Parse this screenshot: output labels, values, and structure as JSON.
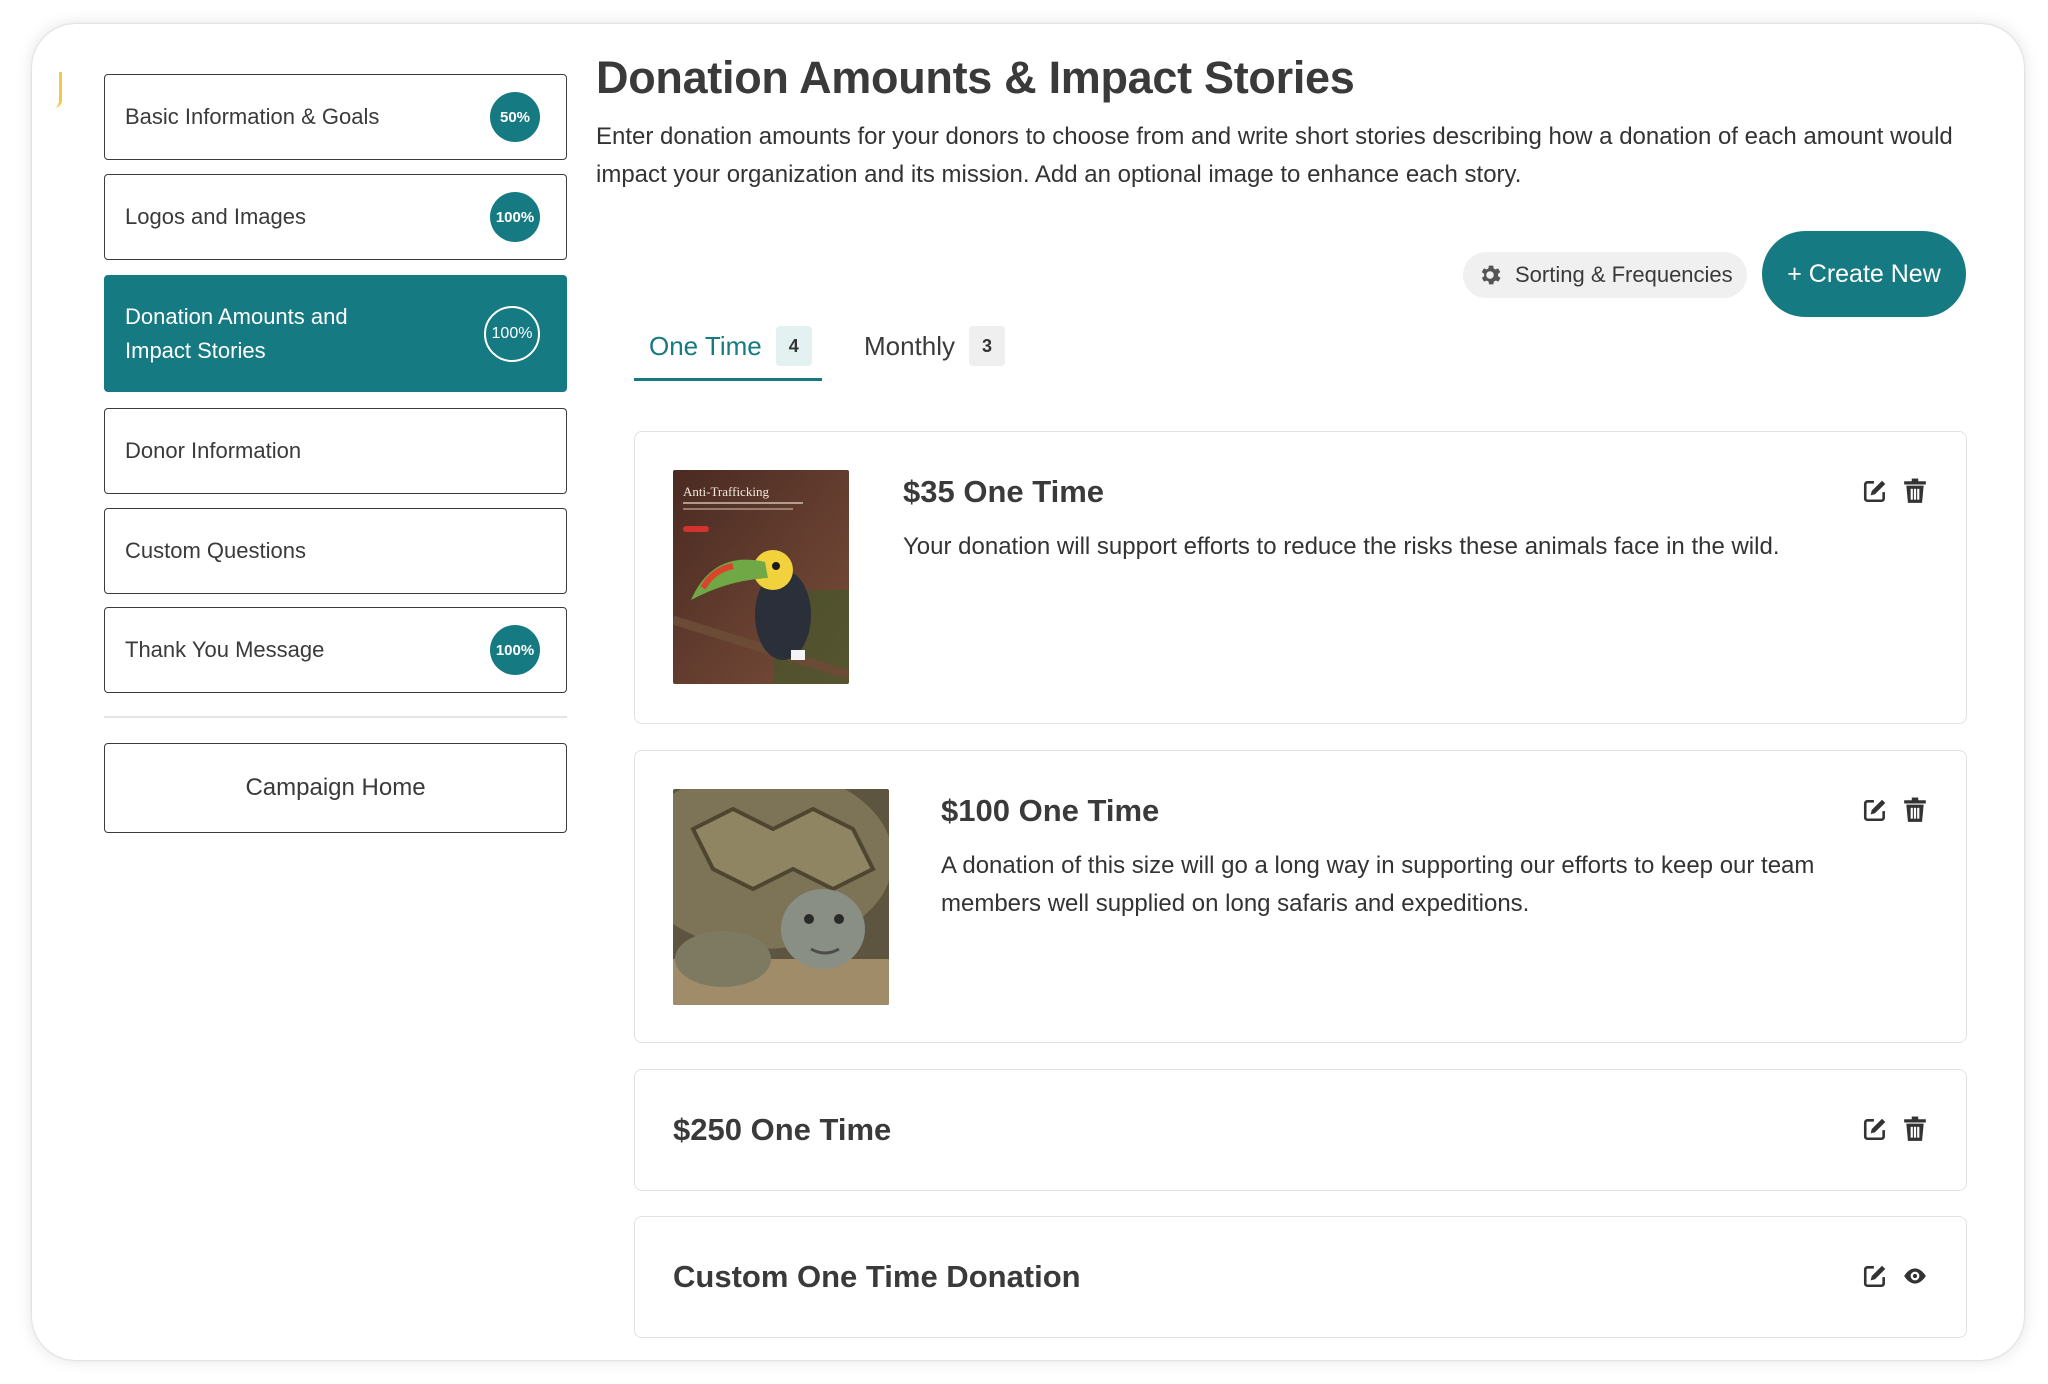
{
  "sidebar": {
    "steps": [
      {
        "label": "Basic Information & Goals",
        "badge": "50%"
      },
      {
        "label": "Logos and Images",
        "badge": "100%"
      },
      {
        "label": "Donation Amounts and Impact Stories",
        "badge": "100%"
      },
      {
        "label": "Donor Information",
        "badge": ""
      },
      {
        "label": "Custom Questions",
        "badge": ""
      },
      {
        "label": "Thank You Message",
        "badge": "100%"
      }
    ],
    "home_label": "Campaign Home"
  },
  "main": {
    "title": "Donation Amounts & Impact Stories",
    "description": "Enter donation amounts for your donors to choose from and write short stories describing how a donation of each amount would impact your organization and its mission. Add an optional image to enhance each story.",
    "sorting_label": "Sorting & Frequencies",
    "create_label": "+ Create New",
    "tabs": [
      {
        "label": "One Time",
        "count": "4"
      },
      {
        "label": "Monthly",
        "count": "3"
      }
    ],
    "cards": [
      {
        "amount": "$35 One Time",
        "story": "Your donation will support efforts to reduce the risks these animals face in the wild.",
        "image_text": "Anti-Trafficking"
      },
      {
        "amount": "$100 One Time",
        "story": "A donation of this size will go a long way in supporting our efforts to keep our team members well supplied on long safaris and expeditions."
      },
      {
        "amount": "$250 One Time",
        "story": ""
      },
      {
        "amount": "Custom One Time Donation",
        "story": ""
      }
    ]
  },
  "colors": {
    "accent": "#167a82",
    "text": "#3a3a3a"
  },
  "icons": [
    "gear-icon",
    "edit-icon",
    "trash-icon",
    "eye-icon"
  ]
}
